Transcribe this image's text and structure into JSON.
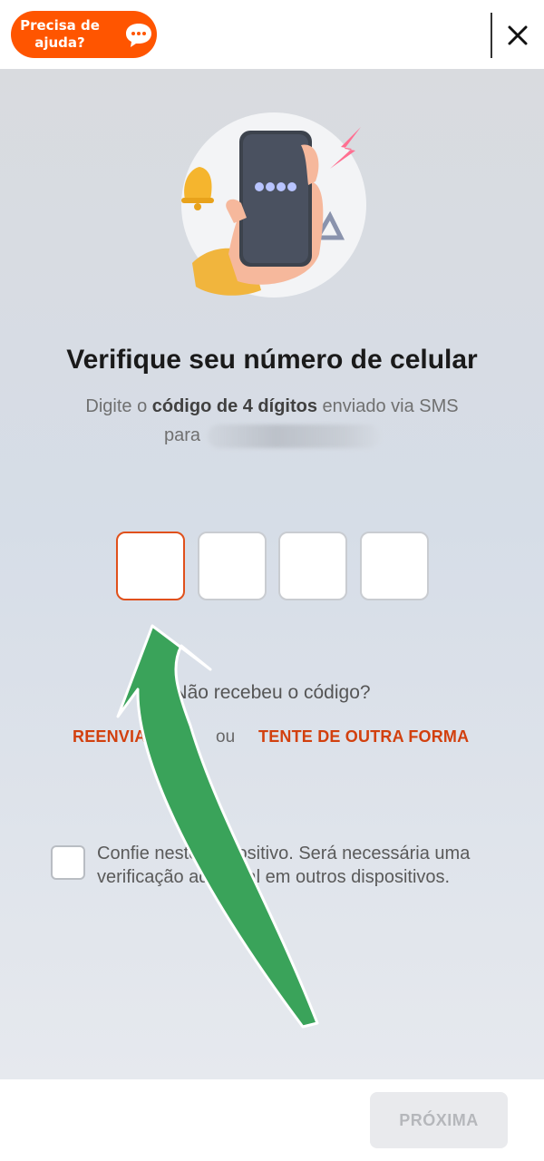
{
  "header": {
    "help_label": "Precisa de\najuda?",
    "help_icon": "chat-bubble-icon",
    "close_icon": "close-icon"
  },
  "verification": {
    "title": "Verifique seu número de celular",
    "subtitle_prefix": "Digite o ",
    "subtitle_bold": "código de 4 dígitos",
    "subtitle_suffix": " enviado via SMS",
    "subtitle_line2": "para",
    "code_length": 4
  },
  "resend": {
    "question": "Não recebeu o código?",
    "resend_label": "REENVIAR",
    "or_label": "ou",
    "other_way_label": "TENTE DE OUTRA FORMA"
  },
  "trust_device": {
    "label": "Confie neste dispositivo. Será necessária uma verificação adicional em outros dispositivos.",
    "checked": false
  },
  "footer": {
    "next_label": "PRÓXIMA",
    "enabled": false
  },
  "colors": {
    "accent": "#ff5500",
    "link": "#d2400e",
    "annotation_arrow": "#3aa35a"
  }
}
